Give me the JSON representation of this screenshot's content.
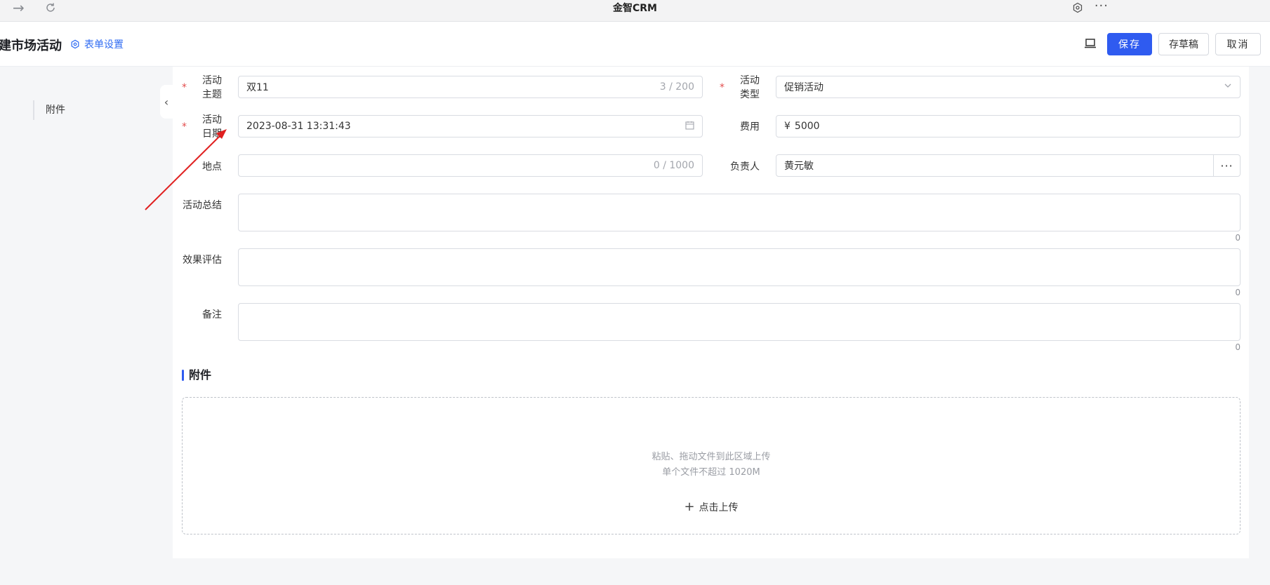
{
  "window": {
    "title": "金智CRM",
    "more": "···"
  },
  "header": {
    "page_title": "建市场活动",
    "form_settings": "表单设置",
    "save": "保存",
    "draft": "存草稿",
    "cancel": "取消"
  },
  "side": {
    "anchor_attachment": "附件"
  },
  "form": {
    "subject": {
      "label": "活动主题",
      "value": "双11",
      "count": "3 / 200",
      "required": "*"
    },
    "type": {
      "label": "活动类型",
      "value": "促销活动",
      "required": "*"
    },
    "date": {
      "label": "活动日期",
      "value": "2023-08-31 13:31:43",
      "required": "*"
    },
    "cost": {
      "label": "费用",
      "prefix": "¥",
      "value": "5000"
    },
    "location": {
      "label": "地点",
      "value": "",
      "count": "0 / 1000"
    },
    "owner": {
      "label": "负责人",
      "value": "黄元敏",
      "more": "···"
    },
    "summary": {
      "label": "活动总结",
      "count": "0"
    },
    "evaluation": {
      "label": "效果评估",
      "count": "0"
    },
    "remark": {
      "label": "备注",
      "count": "0"
    }
  },
  "attachment": {
    "title": "附件",
    "hint1": "粘贴、拖动文件到此区域上传",
    "hint2": "单个文件不超过 1020M",
    "upload": "点击上传"
  },
  "colors": {
    "primary": "#2f5bf0",
    "required": "#e34d4d",
    "annotation": "#e02020"
  }
}
